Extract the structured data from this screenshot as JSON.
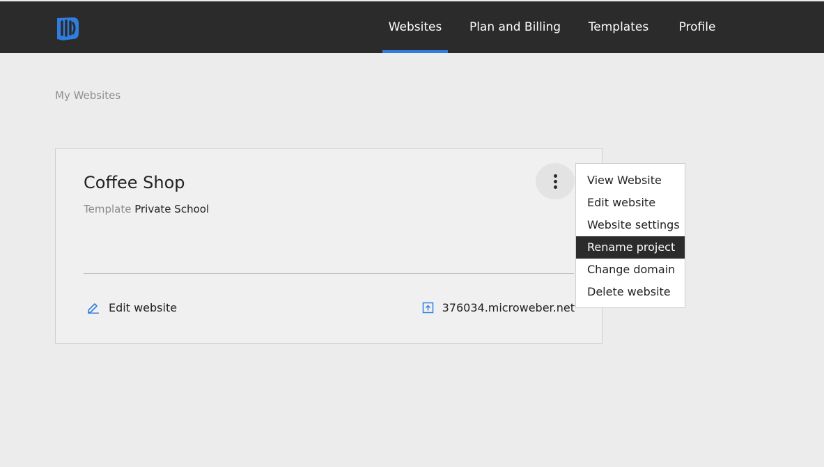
{
  "nav": {
    "websites": "Websites",
    "plan_billing": "Plan and Billing",
    "templates": "Templates",
    "profile": "Profile"
  },
  "page": {
    "heading": "My Websites"
  },
  "card": {
    "title": "Coffee Shop",
    "template_label": "Template",
    "template_name": "Private School",
    "edit_label": "Edit website",
    "domain": "376034.microweber.net"
  },
  "menu": {
    "items": [
      "View Website",
      "Edit website",
      "Website settings",
      "Rename project",
      "Change domain",
      "Delete website"
    ],
    "highlighted": "Rename project"
  },
  "icons": {
    "logo": "microweber-logo",
    "kebab": "more-vertical-icon",
    "edit": "pencil-icon",
    "domain": "external-link-icon"
  },
  "colors": {
    "topbar": "#2b2b2b",
    "accent": "#2f7de1",
    "background": "#ececec"
  }
}
